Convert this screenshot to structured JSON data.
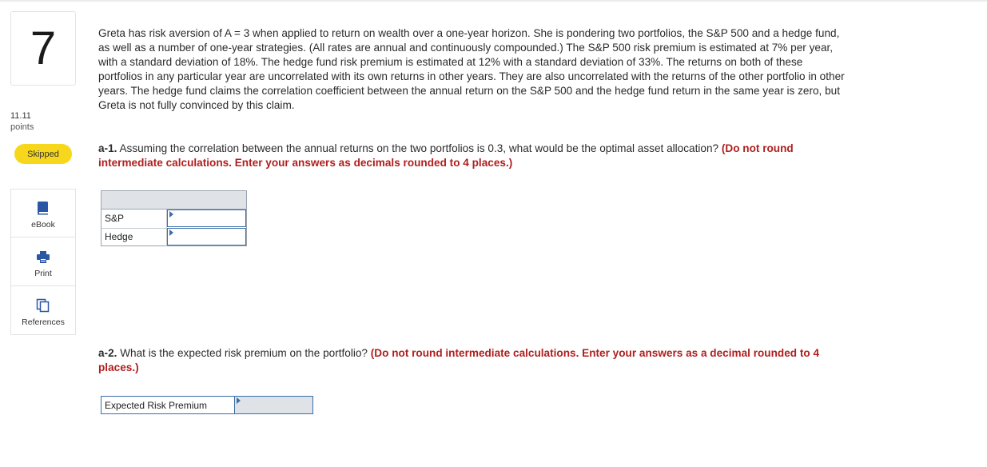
{
  "question": {
    "number": "7",
    "points_value": "11.11",
    "points_label": "points",
    "status": "Skipped"
  },
  "tools": [
    {
      "label": "eBook",
      "icon": "book-icon"
    },
    {
      "label": "Print",
      "icon": "printer-icon"
    },
    {
      "label": "References",
      "icon": "documents-icon"
    }
  ],
  "prompt": "Greta has risk aversion of A = 3 when applied to return on wealth over a one-year horizon. She is pondering two portfolios, the S&P 500 and a hedge fund, as well as a number of one-year strategies. (All rates are annual and continuously compounded.) The S&P 500 risk premium is estimated at 7% per year, with a standard deviation of 18%. The hedge fund risk premium is estimated at 12% with a standard deviation of 33%. The returns on both of these portfolios in any particular year are uncorrelated with its own returns in other years. They are also uncorrelated with the returns of the other portfolio in other years. The hedge fund claims the correlation coefficient between the annual return on the S&P 500 and the hedge fund return in the same year is zero, but Greta is not fully convinced by this claim.",
  "a1": {
    "tag": "a-1.",
    "text": " Assuming the correlation between the annual returns on the two portfolios is 0.3, what would be the optimal asset allocation? ",
    "instruction": "(Do not round intermediate calculations. Enter your answers as decimals rounded to 4 places.)",
    "rows": [
      {
        "label": "S&P",
        "value": ""
      },
      {
        "label": "Hedge",
        "value": ""
      }
    ]
  },
  "a2": {
    "tag": "a-2.",
    "text": " What is the expected risk premium on the portfolio? ",
    "instruction": "(Do not round intermediate calculations. Enter your answers as a decimal rounded to 4 places.)",
    "row_label": "Expected Risk Premium",
    "value": ""
  },
  "colors": {
    "accent_blue": "#3b6da8",
    "badge_yellow": "#f7d71c",
    "instruction_red": "#b01e1e"
  }
}
